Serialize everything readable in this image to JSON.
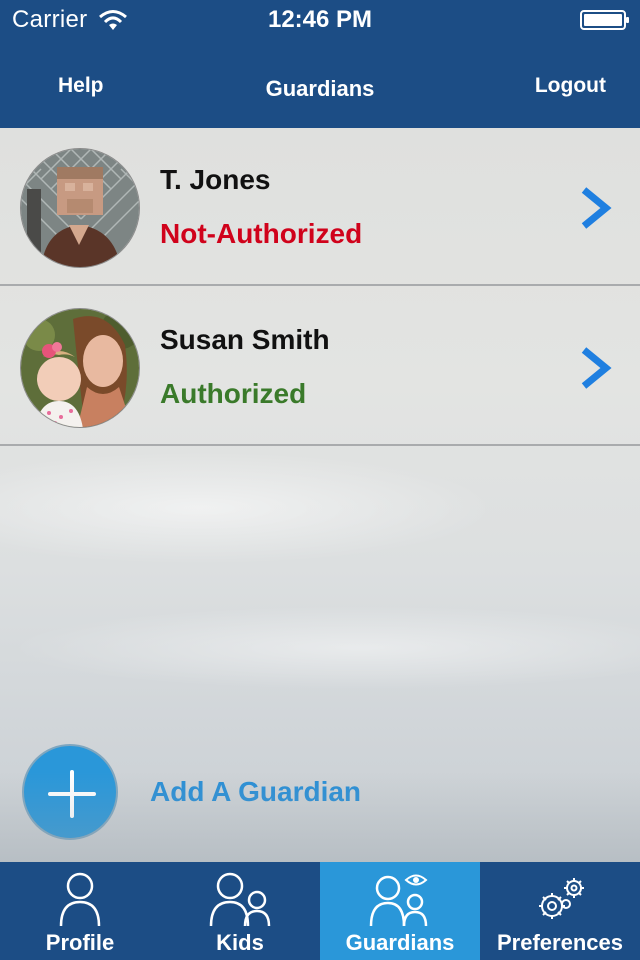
{
  "status_bar": {
    "carrier": "Carrier",
    "time": "12:46 PM"
  },
  "nav": {
    "left": "Help",
    "title": "Guardians",
    "right": "Logout"
  },
  "guardians": [
    {
      "name": "T. Jones",
      "status": "Not-Authorized",
      "status_color": "#d0021b"
    },
    {
      "name": "Susan Smith",
      "status": "Authorized",
      "status_color": "#3a7a2a"
    }
  ],
  "add_guardian": {
    "label": "Add A Guardian"
  },
  "tabs": [
    {
      "label": "Profile",
      "icon": "person-icon",
      "active": false
    },
    {
      "label": "Kids",
      "icon": "people-icon",
      "active": false
    },
    {
      "label": "Guardians",
      "icon": "guardians-eye-icon",
      "active": true
    },
    {
      "label": "Preferences",
      "icon": "gears-icon",
      "active": false
    }
  ],
  "colors": {
    "primary": "#1c4d85",
    "accent": "#2a97d9",
    "chevron": "#1f7fe0"
  }
}
